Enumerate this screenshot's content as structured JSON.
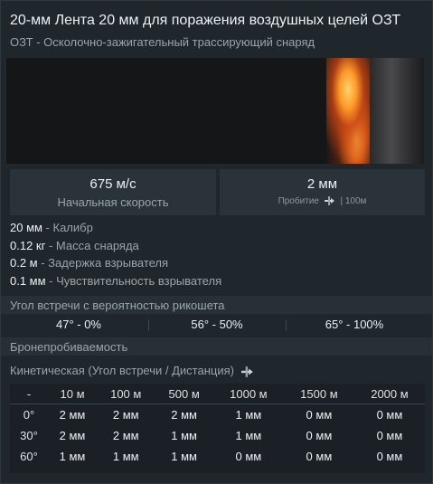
{
  "header": {
    "title": "20-мм Лента 20 мм для поражения воздушных целей ОЗТ",
    "subtitle": "ОЗТ - Осколочно-зажигательный трассирующий снаряд"
  },
  "stats": {
    "velocity": {
      "value": "675 м/с",
      "label": "Начальная скорость"
    },
    "penetration": {
      "value": "2 мм",
      "label": "Пробитие",
      "distance": "| 100м"
    }
  },
  "properties": [
    {
      "value": "20 мм",
      "label": " - Калибр"
    },
    {
      "value": "0.12 кг",
      "label": " - Масса снаряда"
    },
    {
      "value": "0.2 м",
      "label": " - Задержка взрывателя"
    },
    {
      "value": "0.1 мм",
      "label": " - Чувствительность взрывателя"
    }
  ],
  "ricochet": {
    "title": "Угол встречи с вероятностью рикошета",
    "values": [
      "47° - 0%",
      "56° - 50%",
      "65° - 100%"
    ]
  },
  "armor": {
    "title": "Бронепробиваемость",
    "kinetic_title": "Кинетическая (Угол встречи / Дистанция)",
    "columns": [
      "-",
      "10 м",
      "100 м",
      "500 м",
      "1000 м",
      "1500 м",
      "2000 м"
    ],
    "rows": [
      {
        "angle": "0°",
        "values": [
          "2 мм",
          "2 мм",
          "2 мм",
          "1 мм",
          "0 мм",
          "0 мм"
        ]
      },
      {
        "angle": "30°",
        "values": [
          "2 мм",
          "2 мм",
          "1 мм",
          "1 мм",
          "0 мм",
          "0 мм"
        ]
      },
      {
        "angle": "60°",
        "values": [
          "1 мм",
          "1 мм",
          "1 мм",
          "0 мм",
          "0 мм",
          "0 мм"
        ]
      }
    ]
  },
  "icons": {
    "penetration": "penetration-icon"
  }
}
